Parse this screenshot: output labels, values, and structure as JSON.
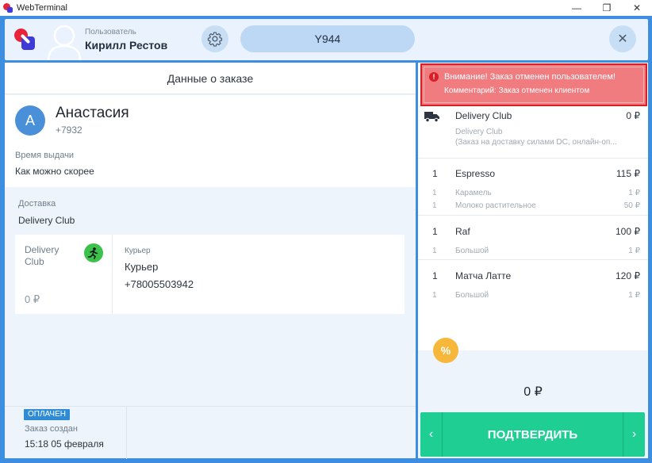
{
  "window": {
    "title": "WebTerminal",
    "minimize_glyph": "—",
    "maximize_glyph": "❐",
    "close_glyph": "✕"
  },
  "header": {
    "user_label": "Пользователь",
    "user_name": "Кирилл Рестов",
    "order_code": "Y944",
    "close_glyph": "✕",
    "icons": [
      "app-logo",
      "user-silhouette-icon",
      "gear-icon",
      "close-icon"
    ]
  },
  "order": {
    "title": "Данные о заказе",
    "customer": {
      "initial": "А",
      "name": "Анастасия",
      "phone": "+7932"
    },
    "pickup_label": "Время выдачи",
    "pickup_value": "Как можно скорее",
    "delivery_label": "Доставка",
    "delivery_value": "Delivery Club",
    "courier_card": {
      "service": "Delivery Club",
      "price": "0 ₽",
      "courier_label": "Курьер",
      "courier_name": "Курьер",
      "courier_phone": "+78005503942"
    },
    "status_badge": "ОПЛАЧЕН",
    "created_label": "Заказ создан",
    "created_value": "15:18 05 февраля"
  },
  "alert": {
    "icon": "!",
    "title": "Внимание! Заказ отменен пользователем!",
    "comment": "Комментарий: Заказ отменен клиентом"
  },
  "cart": {
    "delivery": {
      "name": "Delivery Club",
      "price": "0 ₽",
      "sub1": "Delivery Club",
      "sub2": "(Заказ на доставку силами DC, онлайн-оп..."
    },
    "items": [
      {
        "qty": "1",
        "name": "Espresso",
        "price": "115 ₽",
        "mods": [
          {
            "qty": "1",
            "name": "Карамель",
            "price": "1 ₽"
          },
          {
            "qty": "1",
            "name": "Молоко растительное",
            "price": "50 ₽"
          }
        ]
      },
      {
        "qty": "1",
        "name": "Raf",
        "price": "100 ₽",
        "mods": [
          {
            "qty": "1",
            "name": "Большой",
            "price": "1 ₽"
          }
        ]
      },
      {
        "qty": "1",
        "name": "Матча Латте",
        "price": "120 ₽",
        "mods": [
          {
            "qty": "1",
            "name": "Большой",
            "price": "1 ₽"
          }
        ]
      }
    ],
    "discount_glyph": "%",
    "total": "0 ₽",
    "confirm_label": "ПОДТВЕРДИТЬ",
    "prev_glyph": "‹",
    "next_glyph": "›"
  },
  "colors": {
    "frame": "#3d8ee0",
    "alert_bg": "#f07c80",
    "alert_border": "#d81e26",
    "confirm": "#1fce93",
    "discount": "#f7b73a",
    "paid_badge": "#2f8bd6"
  }
}
